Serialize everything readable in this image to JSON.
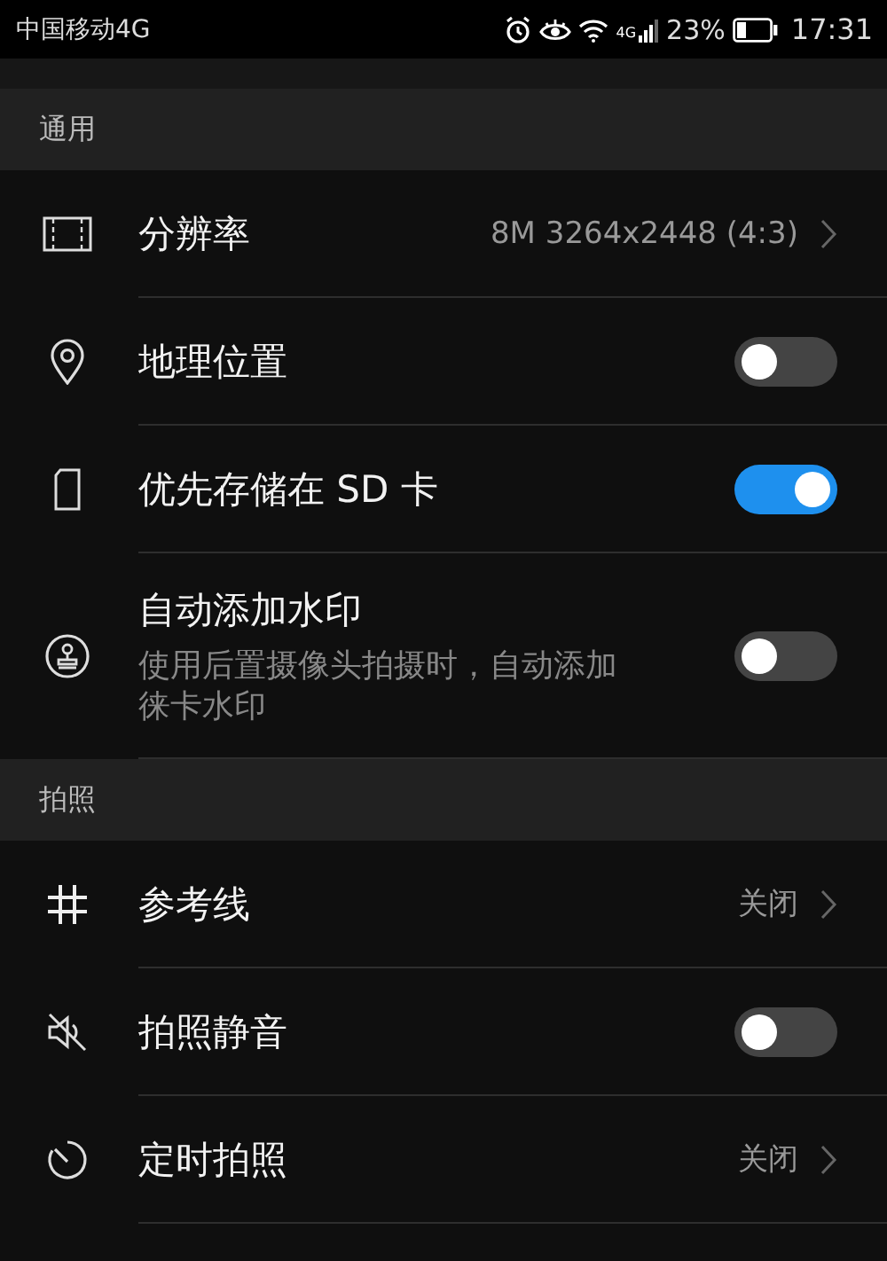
{
  "status_bar": {
    "carrier": "中国移动4G",
    "network": "4G",
    "battery": "23%",
    "time": "17:31"
  },
  "sections": [
    {
      "header": "通用",
      "rows": [
        {
          "kind": "value",
          "label": "分辨率",
          "value": "8M 3264x2448 (4:3)"
        },
        {
          "kind": "toggle",
          "label": "地理位置",
          "on": false
        },
        {
          "kind": "toggle",
          "label": "优先存储在 SD 卡",
          "on": true
        },
        {
          "kind": "toggle",
          "label": "自动添加水印",
          "description": "使用后置摄像头拍摄时，自动添加徕卡水印",
          "on": false
        }
      ]
    },
    {
      "header": "拍照",
      "rows": [
        {
          "kind": "value",
          "label": "参考线",
          "value": "关闭"
        },
        {
          "kind": "toggle",
          "label": "拍照静音",
          "on": false
        },
        {
          "kind": "value",
          "label": "定时拍照",
          "value": "关闭"
        }
      ]
    }
  ]
}
